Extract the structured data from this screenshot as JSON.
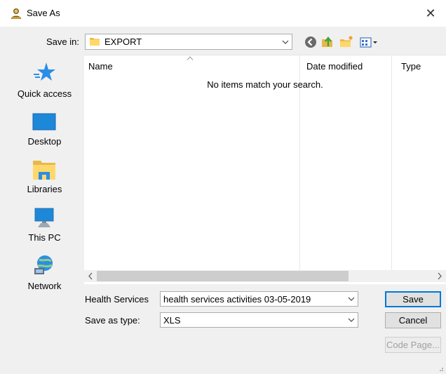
{
  "window": {
    "title": "Save As",
    "icon": "save-as-user-icon",
    "close_glyph": "✕"
  },
  "toolbar": {
    "save_in_label": "Save in:",
    "save_in_value": "EXPORT",
    "icons": [
      "back-icon",
      "up-folder-icon",
      "new-folder-icon",
      "view-menu-icon"
    ]
  },
  "places": [
    {
      "label": "Quick access",
      "icon": "quick-access-star-icon"
    },
    {
      "label": "Desktop",
      "icon": "desktop-icon"
    },
    {
      "label": "Libraries",
      "icon": "libraries-icon"
    },
    {
      "label": "This PC",
      "icon": "this-pc-icon"
    },
    {
      "label": "Network",
      "icon": "network-icon"
    }
  ],
  "filelist": {
    "columns": [
      "Name",
      "Date modified",
      "Type"
    ],
    "empty_message": "No items match your search."
  },
  "form": {
    "filename_label": "Health Services",
    "filename_value": "health services activities 03-05-2019",
    "type_label": "Save as type:",
    "type_value": "XLS"
  },
  "buttons": {
    "save": "Save",
    "cancel": "Cancel",
    "code_page": "Code Page..."
  },
  "colors": {
    "accent": "#0078d7",
    "folder": "#ffd86b",
    "window_bg": "#f0f0f0"
  }
}
